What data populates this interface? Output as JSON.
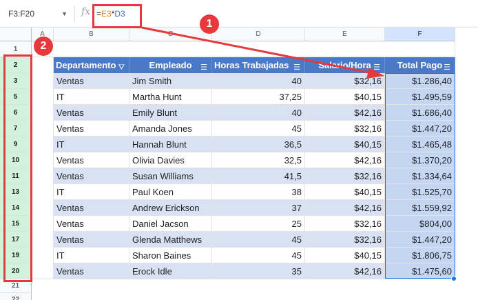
{
  "formula_bar": {
    "name_box": "F3:F20",
    "fx_icon": "function-icon",
    "formula_eq": "=",
    "formula_ref1": "E3",
    "formula_op": "*",
    "formula_ref2": "D3"
  },
  "columns": [
    "A",
    "B",
    "C",
    "D",
    "E",
    "F"
  ],
  "row_numbers_top": [
    "1",
    "2"
  ],
  "row_numbers_data": [
    "3",
    "5",
    "6",
    "7",
    "9",
    "10",
    "11",
    "13",
    "14",
    "15",
    "17",
    "19",
    "20"
  ],
  "row_numbers_bottom": [
    "21",
    "22"
  ],
  "table": {
    "headers": [
      "Departamento",
      "Empleado",
      "Horas Trabajadas",
      "Salario/Hora",
      "Total Pago"
    ],
    "rows": [
      [
        "Ventas",
        "Jim Smith",
        "40",
        "$32,16",
        "$1.286,40"
      ],
      [
        "IT",
        "Martha Hunt",
        "37,25",
        "$40,15",
        "$1.495,59"
      ],
      [
        "Ventas",
        "Emily Blunt",
        "40",
        "$42,16",
        "$1.686,40"
      ],
      [
        "Ventas",
        "Amanda Jones",
        "45",
        "$32,16",
        "$1.447,20"
      ],
      [
        "IT",
        "Hannah Blunt",
        "36,5",
        "$40,15",
        "$1.465,48"
      ],
      [
        "Ventas",
        "Olivia Davies",
        "32,5",
        "$42,16",
        "$1.370,20"
      ],
      [
        "Ventas",
        "Susan Williams",
        "41,5",
        "$32,16",
        "$1.334,64"
      ],
      [
        "IT",
        "Paul Koen",
        "38",
        "$40,15",
        "$1.525,70"
      ],
      [
        "Ventas",
        "Andrew Erickson",
        "37",
        "$42,16",
        "$1.559,92"
      ],
      [
        "Ventas",
        "Daniel Jacson",
        "25",
        "$32,16",
        "$804,00"
      ],
      [
        "Ventas",
        "Glenda Matthews",
        "45",
        "$32,16",
        "$1.447,20"
      ],
      [
        "IT",
        "Sharon Baines",
        "45",
        "$40,15",
        "$1.806,75"
      ],
      [
        "Ventas",
        "Erock Idle",
        "35",
        "$42,16",
        "$1.475,60"
      ]
    ]
  },
  "annotations": {
    "badge1": "1",
    "badge2": "2",
    "color": "#e5393d"
  },
  "colors": {
    "header_blue": "#4a7ac6",
    "band_blue": "#d9e2f3",
    "selection_blue": "#1a73e8"
  }
}
